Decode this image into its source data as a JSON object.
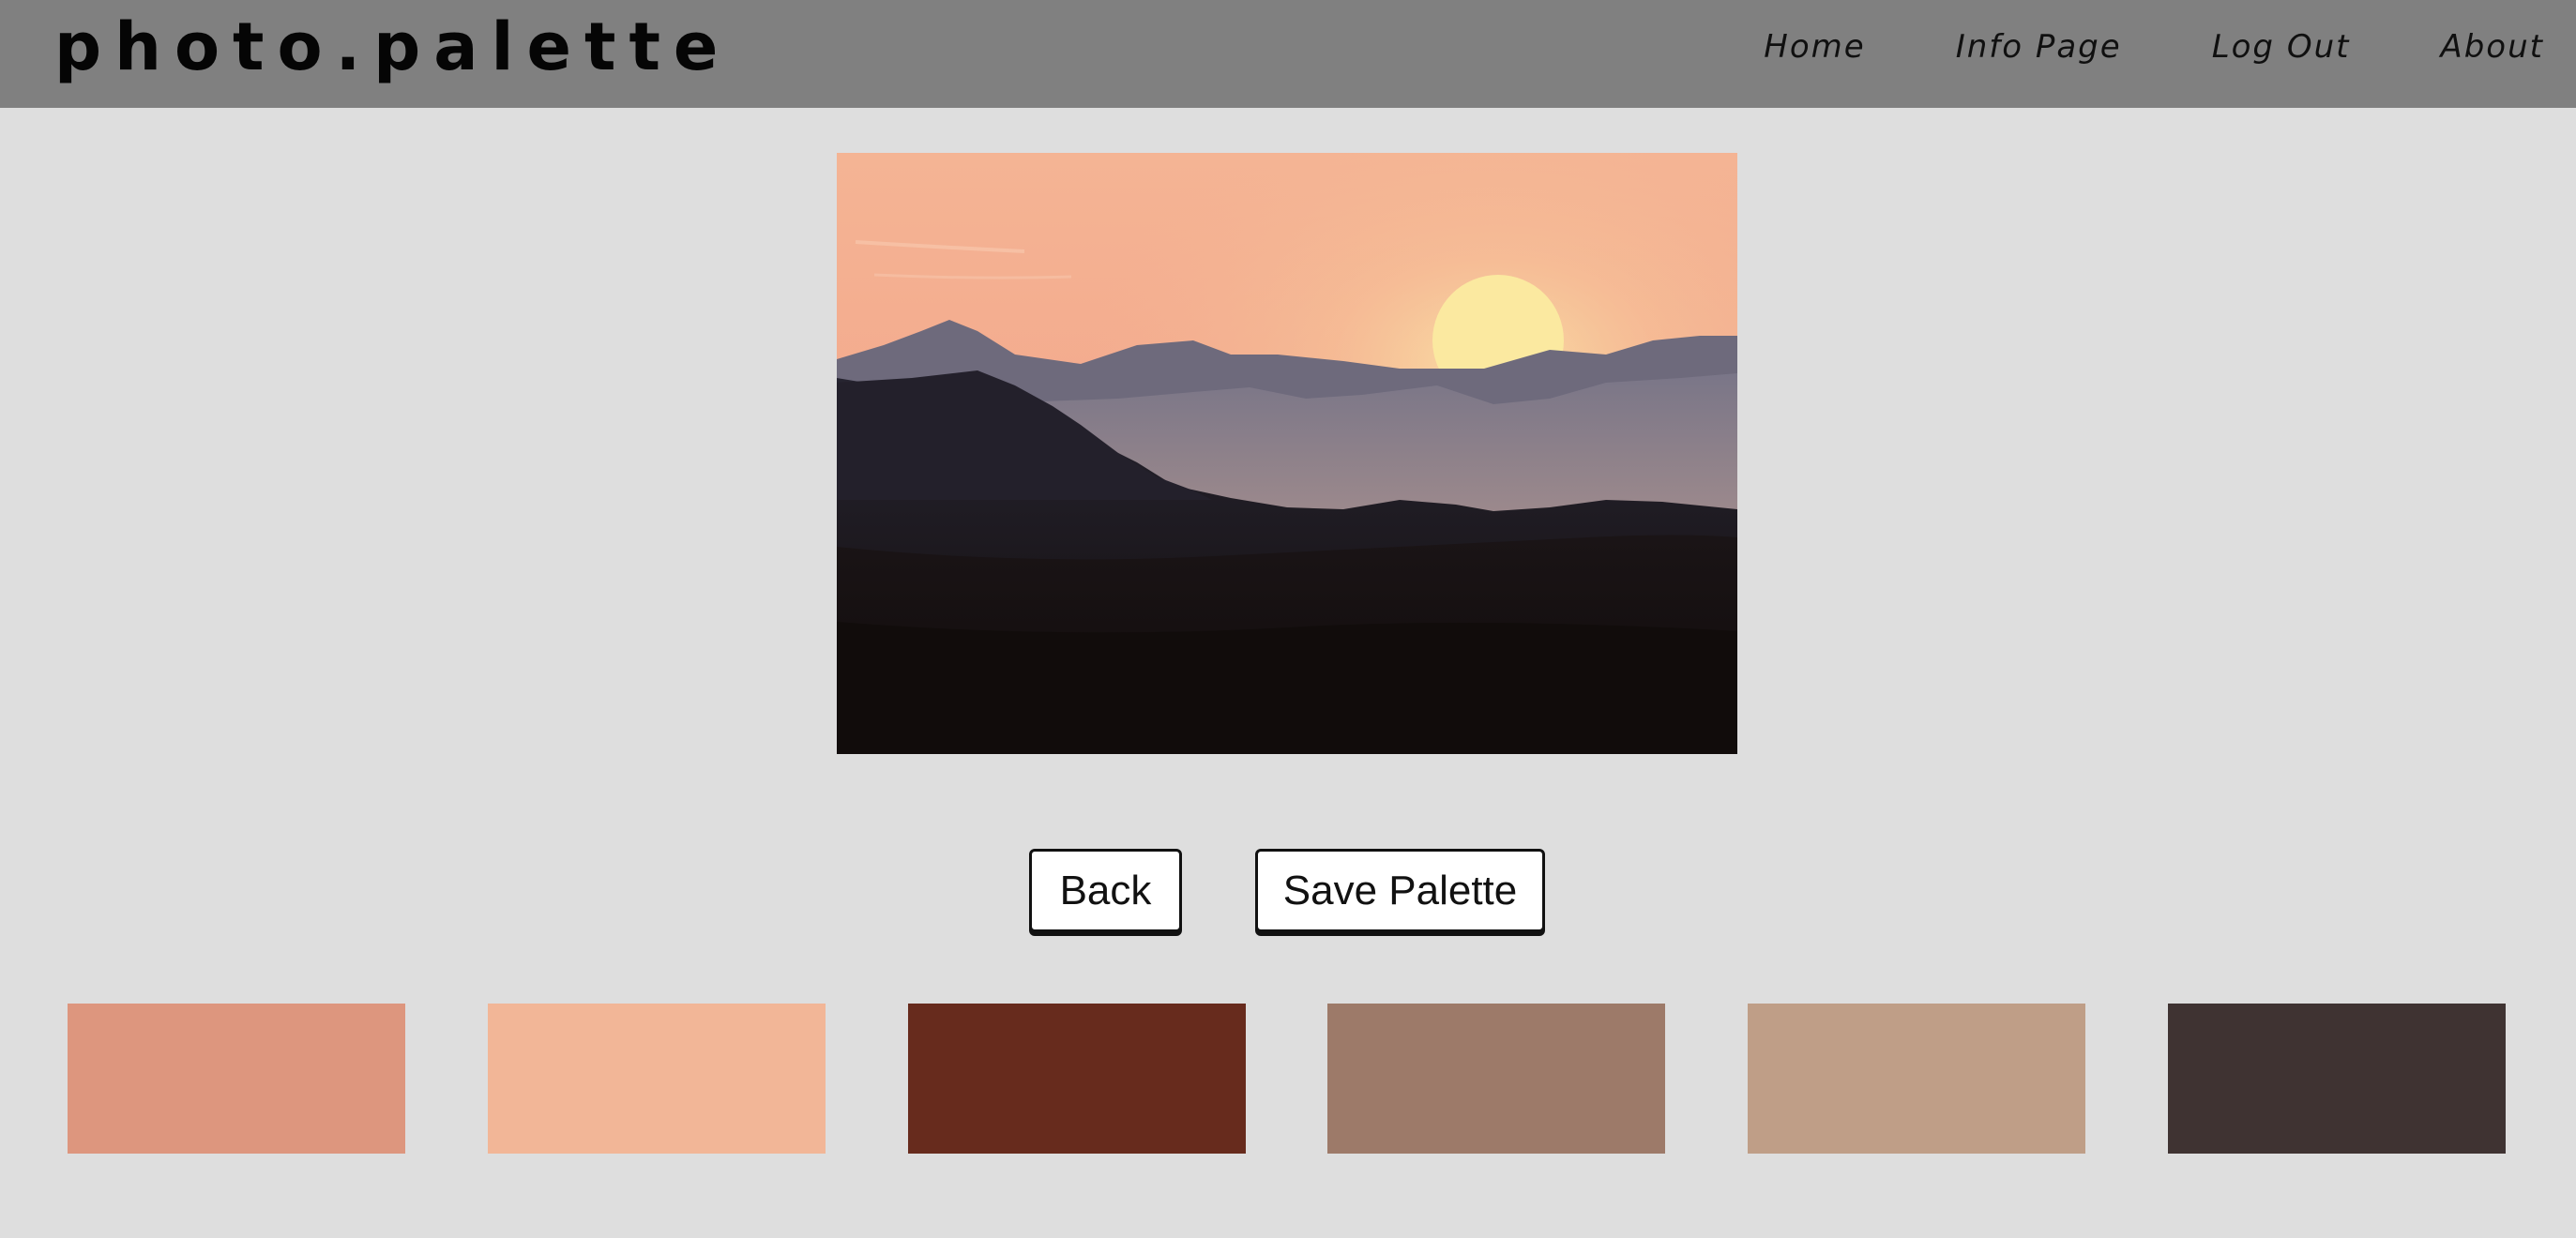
{
  "header": {
    "logo": "photo.palette",
    "nav": [
      "Home",
      "Info Page",
      "Log Out",
      "About"
    ]
  },
  "main": {
    "image_description": "sunset-mountains-photo",
    "buttons": {
      "back": "Back",
      "save": "Save Palette"
    },
    "palette": [
      "#dd967e",
      "#f2b697",
      "#672b1d",
      "#9d7a69",
      "#bf9e87",
      "#3f3332"
    ]
  }
}
